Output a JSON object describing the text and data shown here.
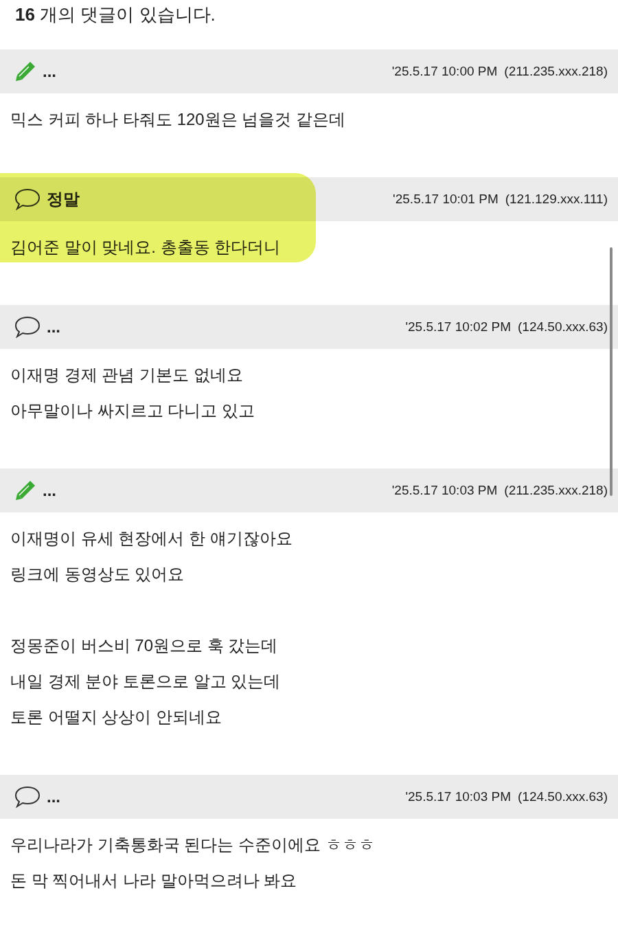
{
  "comment_count": "**16** 개의 댓글이 있습니다.",
  "comments": [
    {
      "kind": "pencil",
      "author": "...",
      "date": "'25.5.17 10:00 PM",
      "ip": "(211.235.xxx.218)",
      "highlighted": false,
      "paragraphs": [
        [
          "믹스 커피 하나 타줘도 120원은 넘을것 같은데"
        ]
      ]
    },
    {
      "kind": "speech",
      "author": "정말",
      "date": "'25.5.17 10:01 PM",
      "ip": "(121.129.xxx.111)",
      "highlighted": true,
      "paragraphs": [
        [
          "김어준 말이 맞네요. 총출동 한다더니"
        ]
      ]
    },
    {
      "kind": "speech",
      "author": "...",
      "date": "'25.5.17 10:02 PM",
      "ip": "(124.50.xxx.63)",
      "highlighted": false,
      "paragraphs": [
        [
          "이재명 경제 관념 기본도 없네요",
          "아무말이나 싸지르고 다니고 있고"
        ]
      ]
    },
    {
      "kind": "pencil",
      "author": "...",
      "date": "'25.5.17 10:03 PM",
      "ip": "(211.235.xxx.218)",
      "highlighted": false,
      "paragraphs": [
        [
          "이재명이 유세 현장에서 한 얘기잖아요",
          "링크에 동영상도 있어요"
        ],
        [
          "정몽준이 버스비 70원으로 훅 갔는데",
          "내일 경제 분야 토론으로 알고 있는데",
          "토론 어떨지 상상이 안되네요"
        ]
      ]
    },
    {
      "kind": "speech",
      "author": "...",
      "date": "'25.5.17 10:03 PM",
      "ip": "(124.50.xxx.63)",
      "highlighted": false,
      "paragraphs": [
        [
          "우리나라가 기축통화국 된다는 수준이에요 ㅎㅎㅎ",
          "돈 막 찍어내서 나라 말아먹으려나 봐요"
        ]
      ]
    }
  ]
}
